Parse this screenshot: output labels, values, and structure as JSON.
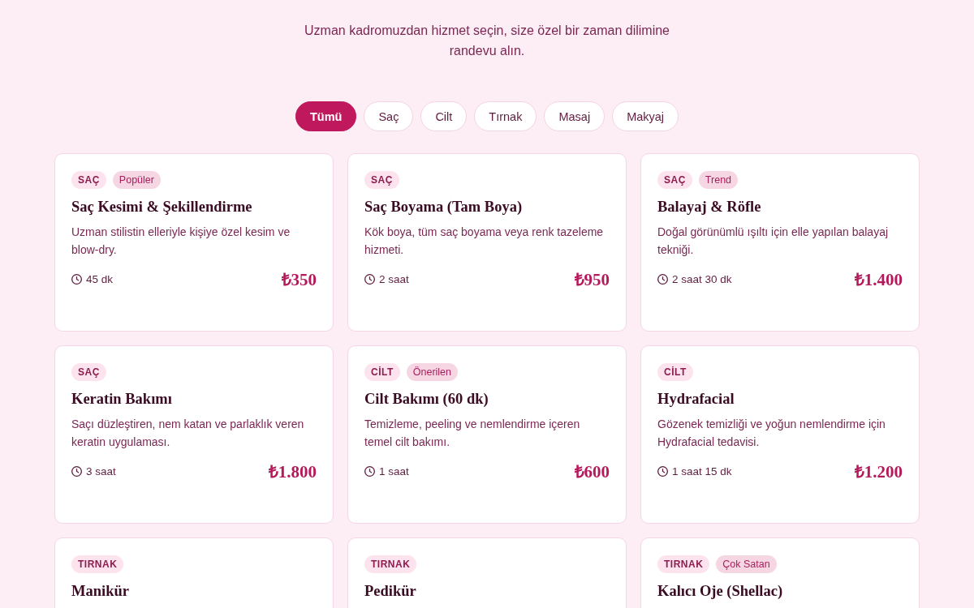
{
  "header": {
    "subtitle": "Uzman kadromuzdan hizmet seçin, size özel bir zaman dilimine randevu alın."
  },
  "filters": [
    {
      "label": "Tümü",
      "selected": true
    },
    {
      "label": "Saç",
      "selected": false
    },
    {
      "label": "Cilt",
      "selected": false
    },
    {
      "label": "Tırnak",
      "selected": false
    },
    {
      "label": "Masaj",
      "selected": false
    },
    {
      "label": "Makyaj",
      "selected": false
    }
  ],
  "services": [
    {
      "category": "SAÇ",
      "badge": "Popüler",
      "title": "Saç Kesimi & Şekillendirme",
      "description": "Uzman stilistin elleriyle kişiye özel kesim ve blow-dry.",
      "duration": "45 dk",
      "price": "₺350"
    },
    {
      "category": "SAÇ",
      "title": "Saç Boyama (Tam Boya)",
      "description": "Kök boya, tüm saç boyama veya renk tazeleme hizmeti.",
      "duration": "2 saat",
      "price": "₺950"
    },
    {
      "category": "SAÇ",
      "badge": "Trend",
      "title": "Balayaj & Röfle",
      "description": "Doğal görünümlü ışıltı için elle yapılan balayaj tekniği.",
      "duration": "2 saat 30 dk",
      "price": "₺1.400"
    },
    {
      "category": "SAÇ",
      "title": "Keratin Bakımı",
      "description": "Saçı düzleştiren, nem katan ve parlaklık veren keratin uygulaması.",
      "duration": "3 saat",
      "price": "₺1.800"
    },
    {
      "category": "CİLT",
      "badge": "Önerilen",
      "title": "Cilt Bakımı (60 dk)",
      "description": "Temizleme, peeling ve nemlendirme içeren temel cilt bakımı.",
      "duration": "1 saat",
      "price": "₺600"
    },
    {
      "category": "CİLT",
      "title": "Hydrafacial",
      "description": "Gözenek temizliği ve yoğun nemlendirme için Hydrafacial tedavisi.",
      "duration": "1 saat 15 dk",
      "price": "₺1.200"
    },
    {
      "category": "TIRNAK",
      "title": "Manikür"
    },
    {
      "category": "TIRNAK",
      "title": "Pedikür"
    },
    {
      "category": "TIRNAK",
      "badge": "Çok Satan",
      "title": "Kalıcı Oje (Shellac)"
    }
  ]
}
